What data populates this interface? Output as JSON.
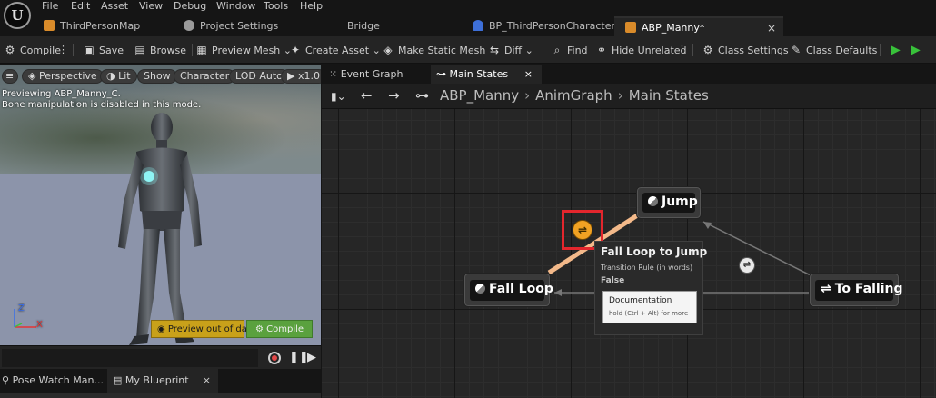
{
  "menu": [
    "File",
    "Edit",
    "Asset",
    "View",
    "Debug",
    "Window",
    "Tools",
    "Help"
  ],
  "tabs": [
    {
      "label": "ThirdPersonMap"
    },
    {
      "label": "Project Settings"
    },
    {
      "label": "Bridge"
    },
    {
      "label": "BP_ThirdPersonCharacter"
    },
    {
      "label": "ABP_Manny*",
      "close": "×"
    }
  ],
  "toolbar": {
    "compile": "Compile",
    "save": "Save",
    "browse": "Browse",
    "preview_mesh": "Preview Mesh",
    "create_asset": "Create Asset",
    "make_static_mesh": "Make Static Mesh",
    "diff": "Diff",
    "find": "Find",
    "hide_unrelated": "Hide Unrelated",
    "class_settings": "Class Settings",
    "class_defaults": "Class Defaults"
  },
  "viewport": {
    "perspective": "Perspective",
    "lit": "Lit",
    "show": "Show",
    "character": "Character",
    "lod": "LOD Auto",
    "speed": "x1.0",
    "msg1": "Previewing ABP_Manny_C.",
    "msg2": "Bone manipulation is disabled in this mode.",
    "axis_z": "Z",
    "axis_x": "X",
    "preview_out": "Preview out of date",
    "compile": "Compile"
  },
  "bottom_tabs": [
    {
      "label": "Pose Watch Man..."
    },
    {
      "label": "My Blueprint",
      "close": "×"
    }
  ],
  "graph_tabs": [
    {
      "label": "Event Graph"
    },
    {
      "label": "Main States",
      "close": "×"
    }
  ],
  "breadcrumb": [
    "ABP_Manny",
    "AnimGraph",
    "Main States"
  ],
  "nodes": {
    "jump": "Jump",
    "fall_loop": "Fall Loop",
    "to_falling": "To Falling"
  },
  "tooltip": {
    "title": "Fall Loop to Jump",
    "subtitle": "Transition Rule (in words)",
    "value": "False",
    "doc_title": "Documentation",
    "doc_hint": "hold (Ctrl + Alt) for more"
  },
  "colors": {
    "accent_transition": "#f0a223",
    "highlight": "#e3262d",
    "play": "#38c23a"
  }
}
